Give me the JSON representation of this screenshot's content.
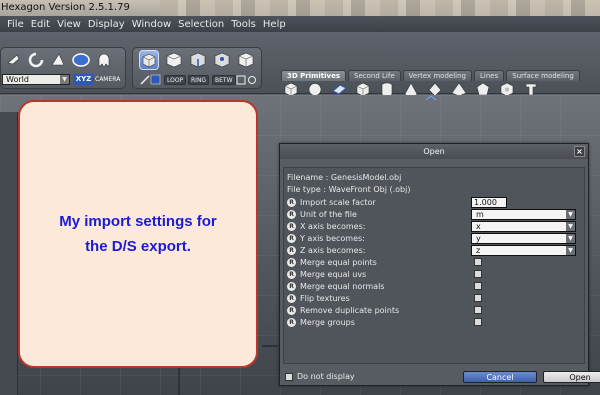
{
  "app": {
    "title": "Hexagon Version 2.5.1.79"
  },
  "menu": [
    "File",
    "Edit",
    "View",
    "Display",
    "Window",
    "Selection",
    "Tools",
    "Help"
  ],
  "toolbar": {
    "world_select": "World",
    "xyz_label": "XYZ",
    "camera_label": "CAMERA",
    "loop_label": "LOOP",
    "ring_label": "RING",
    "betw_label": "BETW",
    "tabs": [
      "3D Primitives",
      "Second Life",
      "Vertex modeling",
      "Lines",
      "Surface modeling"
    ],
    "active_tab": "3D Primitives",
    "primitive_icons": [
      "cube-icon",
      "sphere-icon",
      "plane-icon",
      "cube-icon",
      "cylinder-icon",
      "cone-icon",
      "diamond-icon",
      "pyramid-icon",
      "dodecahedron-icon",
      "geosphere-icon",
      "tube-icon"
    ]
  },
  "callout": {
    "text": "My import settings for\nthe D/S export."
  },
  "dialog": {
    "title": "Open",
    "close_label": "×",
    "filename": "Filename : GenesisModel.obj",
    "filetype": "File type : WaveFront Obj  (.obj)",
    "badge": "R",
    "options": [
      {
        "label": "Import scale factor",
        "kind": "text",
        "value": "1.000"
      },
      {
        "label": "Unit of the file",
        "kind": "select",
        "value": "m"
      },
      {
        "label": "X axis becomes:",
        "kind": "select",
        "value": "x"
      },
      {
        "label": "Y axis becomes:",
        "kind": "select",
        "value": "y"
      },
      {
        "label": "Z axis becomes:",
        "kind": "select",
        "value": "z"
      },
      {
        "label": "Merge equal points",
        "kind": "check",
        "checked": false
      },
      {
        "label": "Merge equal uvs",
        "kind": "check",
        "checked": false
      },
      {
        "label": "Merge equal normals",
        "kind": "check",
        "checked": false
      },
      {
        "label": "Flip textures",
        "kind": "check",
        "checked": false
      },
      {
        "label": "Remove duplicate points",
        "kind": "check",
        "checked": false
      },
      {
        "label": "Merge groups",
        "kind": "check",
        "checked": false
      }
    ],
    "do_not_display": "Do not display",
    "cancel": "Cancel",
    "open": "Open"
  },
  "colors": {
    "callout_border": "#b8372b",
    "callout_text": "#1b1bd6",
    "cancel_button": "#3f62ad"
  }
}
